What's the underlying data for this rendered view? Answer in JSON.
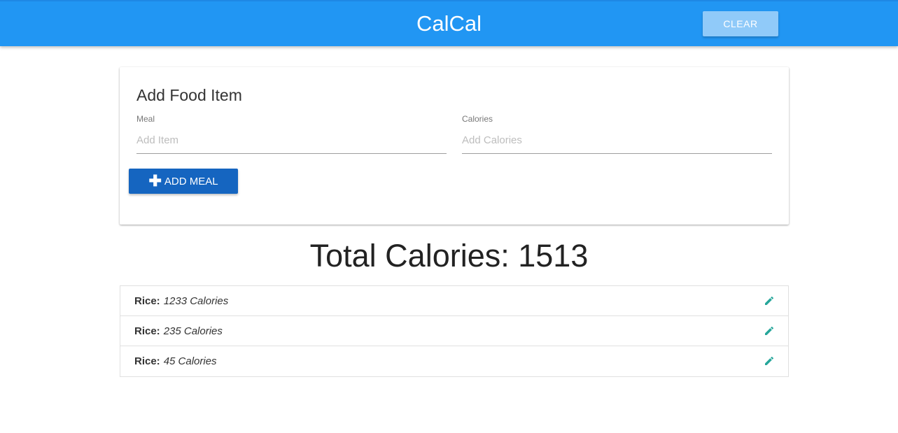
{
  "header": {
    "brand": "CalCal",
    "clear_label": "CLEAR"
  },
  "form": {
    "title": "Add Food Item",
    "meal": {
      "label": "Meal",
      "placeholder": "Add Item",
      "value": ""
    },
    "calories": {
      "label": "Calories",
      "placeholder": "Add Calories",
      "value": ""
    },
    "add_button_label": "ADD MEAL",
    "add_button_icon": "plus-icon"
  },
  "total": {
    "text": "Total Calories: 1513"
  },
  "items": [
    {
      "name": "Rice:",
      "calories": "1233 Calories",
      "icon": "pencil-icon"
    },
    {
      "name": "Rice:",
      "calories": "235 Calories",
      "icon": "pencil-icon"
    },
    {
      "name": "Rice:",
      "calories": "45 Calories",
      "icon": "pencil-icon"
    }
  ],
  "colors": {
    "navbar": "#2196f3",
    "clear_button": "#90caf9",
    "add_button": "#1565c0",
    "edit_icon": "#26a69a"
  }
}
